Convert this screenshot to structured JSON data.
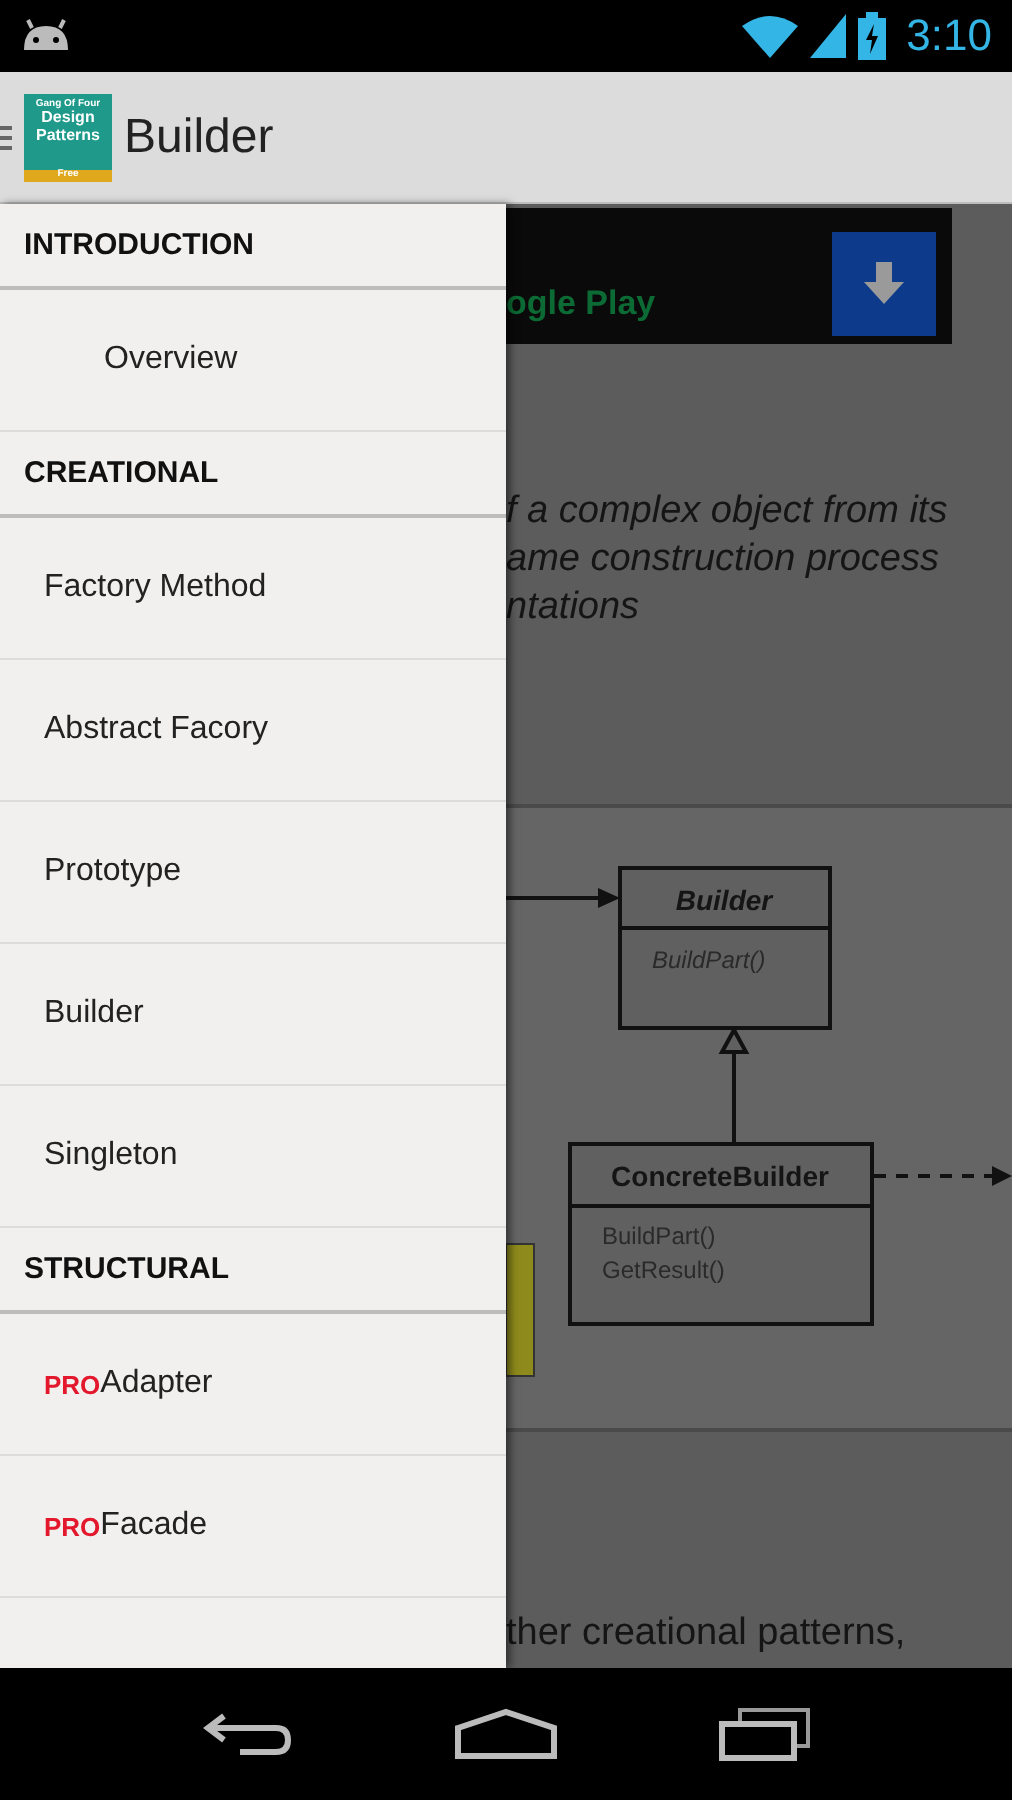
{
  "status_bar": {
    "time": "3:10"
  },
  "action_bar": {
    "title": "Builder",
    "app_icon_lines": [
      "Gang Of Four",
      "Design",
      "Patterns",
      "Free"
    ]
  },
  "drawer": {
    "sections": [
      {
        "header": "INTRODUCTION",
        "items": [
          {
            "label": "Overview",
            "indented": true
          }
        ]
      },
      {
        "header": "CREATIONAL",
        "items": [
          {
            "label": "Factory Method",
            "indented": false
          },
          {
            "label": "Abstract Facory",
            "indented": false
          },
          {
            "label": "Prototype",
            "indented": false
          },
          {
            "label": "Builder",
            "indented": false
          },
          {
            "label": "Singleton",
            "indented": false
          }
        ]
      },
      {
        "header": "STRUCTURAL",
        "items": [
          {
            "label": "Adapter",
            "badge": "PRO",
            "indented": false
          },
          {
            "label": "Facade",
            "badge": "PRO",
            "indented": false
          }
        ]
      }
    ]
  },
  "content": {
    "ad_text": "ogle Play",
    "description": [
      "f a complex object from its",
      "ame construction process",
      "ntations"
    ],
    "diagram": {
      "classes": [
        {
          "name": "Builder",
          "methods": [
            "BuildPart()"
          ],
          "abstract": true
        },
        {
          "name": "ConcreteBuilder",
          "methods": [
            "BuildPart()",
            "GetResult()"
          ],
          "abstract": false
        }
      ]
    },
    "footer_text": "ther creational patterns,"
  }
}
